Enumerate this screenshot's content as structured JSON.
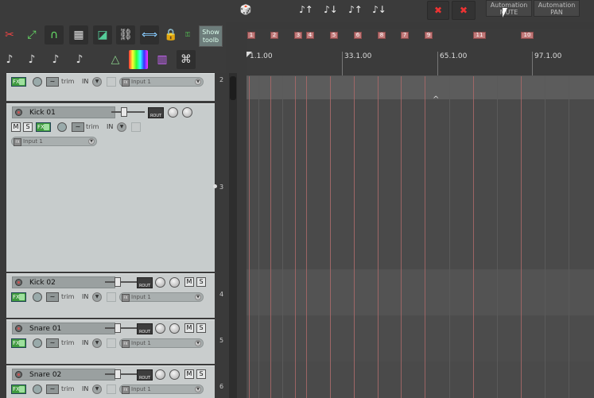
{
  "top_toolbar": {
    "automation_mute": "Automation MUTE",
    "automation_pan": "Automation PAN"
  },
  "left_toolbar": {
    "show_toolbar": "Show toolb"
  },
  "tracks": [
    {
      "num": "2",
      "name": "",
      "input": "Input 1",
      "trim": "trim",
      "in": "IN"
    },
    {
      "num": "3",
      "name": "Kick 01",
      "input": "Input 1",
      "trim": "trim",
      "in": "IN",
      "m": "M",
      "s": "S",
      "fx": "FX",
      "rout": "ROUT"
    },
    {
      "num": "4",
      "name": "Kick 02",
      "input": "Input 1",
      "trim": "trim",
      "in": "IN",
      "m": "M",
      "s": "S",
      "fx": "FX",
      "rout": "ROUT"
    },
    {
      "num": "5",
      "name": "Snare 01",
      "input": "Input 1",
      "trim": "trim",
      "in": "IN",
      "m": "M",
      "s": "S",
      "fx": "FX",
      "rout": "ROUT"
    },
    {
      "num": "6",
      "name": "Snare 02",
      "input": "Input 1",
      "trim": "trim",
      "in": "IN",
      "m": "M",
      "s": "S",
      "fx": "FX",
      "rout": "ROUT"
    }
  ],
  "fx_small": "FX",
  "markers": [
    "1",
    "2",
    "3",
    "4",
    "5",
    "6",
    "8",
    "7",
    "9",
    "11",
    "10"
  ],
  "ruler": {
    "labels": [
      "1.1.00",
      "33.1.00",
      "65.1.00",
      "97.1.00"
    ]
  }
}
